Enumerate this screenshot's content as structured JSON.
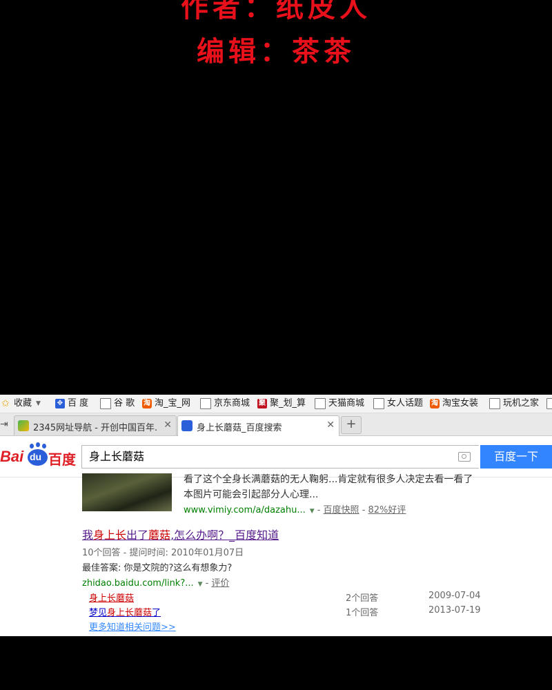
{
  "credits": {
    "line1": "作者：纸皮人",
    "line2": "编辑：茶茶"
  },
  "bookmarks": [
    {
      "label": "收藏",
      "icon": "star-icon"
    },
    {
      "label": "百 度",
      "icon": "baidu-paw-icon"
    },
    {
      "label": "谷 歌",
      "icon": "page-icon"
    },
    {
      "label": "淘_宝_网",
      "icon": "taobao-icon"
    },
    {
      "label": "京东商城",
      "icon": "page-icon"
    },
    {
      "label": "聚_划_算",
      "icon": "juhuasuan-icon"
    },
    {
      "label": "天猫商城",
      "icon": "page-icon"
    },
    {
      "label": "女人话题",
      "icon": "page-icon"
    },
    {
      "label": "淘宝女装",
      "icon": "taobao-icon"
    },
    {
      "label": "玩机之家",
      "icon": "page-icon"
    }
  ],
  "tabs": [
    {
      "label": "2345网址导航 - 开创中国百年...",
      "active": false
    },
    {
      "label": "身上长蘑菇_百度搜索",
      "active": true
    }
  ],
  "search": {
    "logo_latin": "Bai",
    "logo_du": "du",
    "logo_cn": "百度",
    "query": "身上长蘑菇",
    "button_label": "百度一下"
  },
  "result1": {
    "snippet_line1": "看了这个全身长满蘑菇的无人鞠躬...肯定就有很多人决定去看一看了",
    "snippet_line2": "本图片可能会引起部分人心理...",
    "url": "www.vimiy.com/a/dazahu...",
    "cache_link": "百度快照",
    "rating_link": "82%好评"
  },
  "result2": {
    "title_before": "我",
    "title_highlight": "身上长",
    "title_mid": "出了",
    "title_highlight2": "蘑菇",
    "title_after": ",怎么办啊？_百度知道",
    "meta": "10个回答 - 提问时间: 2010年01月07日",
    "best_answer": "最佳答案: 你是文院的?这么有想象力?",
    "url": "zhidao.baidu.com/link?...",
    "rate_link": "评价"
  },
  "related": [
    {
      "question_pre": "",
      "question_hl": "身上长蘑菇",
      "question_post": "",
      "count": "2个回答",
      "date": "2009-07-04"
    },
    {
      "question_pre": "梦见",
      "question_hl": "身上长蘑菇",
      "question_post": "了",
      "count": "1个回答",
      "date": "2013-07-19"
    }
  ],
  "more_link": "更多知道相关问题>>"
}
